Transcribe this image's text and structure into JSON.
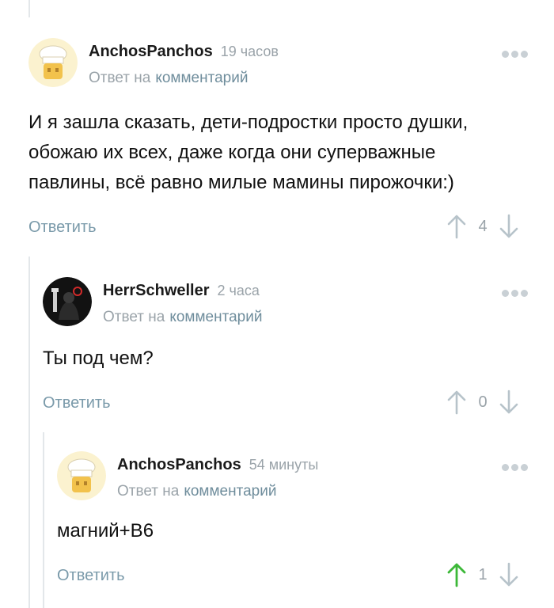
{
  "comments": [
    {
      "author": "AnchosPanchos",
      "time": "19 часов",
      "reply_prefix": "Ответ на",
      "reply_link": "комментарий",
      "text": "И я зашла сказать, дети-подростки просто душки,\nобожаю их всех, даже когда они суперважные\nпавлины, всё равно милые мамины пирожочки:)",
      "reply_label": "Ответить",
      "rating": "4",
      "avatar_icon": "chef-hat-avatar-icon"
    },
    {
      "author": "HerrSchweller",
      "time": "2 часа",
      "reply_prefix": "Ответ на",
      "reply_link": "комментарий",
      "text": "Ты под чем?",
      "reply_label": "Ответить",
      "rating": "0",
      "avatar_icon": "dark-figure-avatar-icon"
    },
    {
      "author": "AnchosPanchos",
      "time": "54 минуты",
      "reply_prefix": "Ответ на",
      "reply_link": "комментарий",
      "text": "магний+В6",
      "reply_label": "Ответить",
      "rating": "1",
      "upvoted": true,
      "avatar_icon": "chef-hat-avatar-icon"
    }
  ],
  "colors": {
    "upvote_active": "#3cb838",
    "arrow_inactive": "#b7c3ca",
    "link": "#6f8d9c",
    "thread_line": "#e3e7ea"
  }
}
